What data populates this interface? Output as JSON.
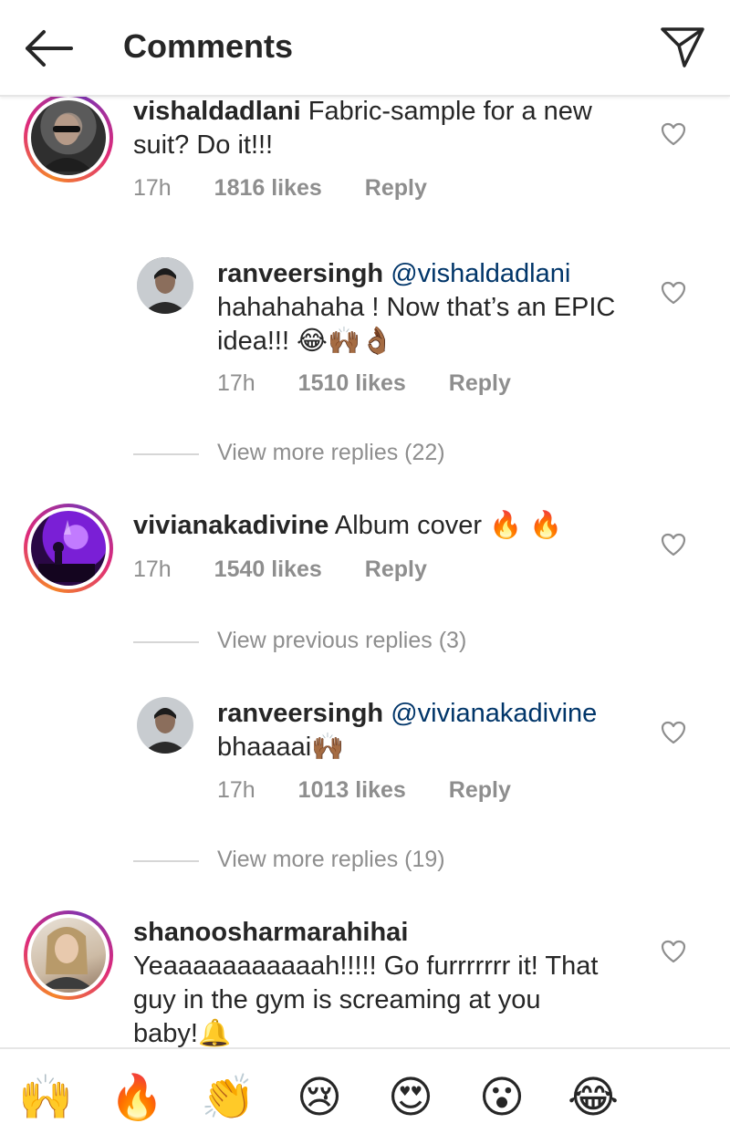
{
  "header": {
    "title": "Comments"
  },
  "comments": [
    {
      "user": "vishaldadlani",
      "text_line1": "Fabric-sample for a new",
      "text_line2": "suit? Do it!!!",
      "time": "17h",
      "likes": "1816 likes",
      "reply": "Reply"
    },
    {
      "user": "ranveersingh",
      "mention": "@vishaldadlani",
      "text_line1": "hahahahaha ! Now that’s an EPIC",
      "text_line2": "idea!!! 😂🙌🏾👌🏾",
      "time": "17h",
      "likes": "1510 likes",
      "reply": "Reply"
    },
    {
      "user": "vivianakadivine",
      "text_line1": "Album cover 🔥 🔥",
      "time": "17h",
      "likes": "1540 likes",
      "reply": "Reply"
    },
    {
      "user": "ranveersingh",
      "mention": "@vivianakadivine",
      "text_line1": "bhaaaai🙌🏾",
      "time": "17h",
      "likes": "1013 likes",
      "reply": "Reply"
    },
    {
      "user": "shanoosharmarahihai",
      "text_line1": "Yeaaaaaaaaaaah!!!!! Go furrrrrrr it! That",
      "text_line2": "guy in the gym is screaming at you",
      "text_line3": "baby!🔔"
    }
  ],
  "view_more_1": "View more replies (22)",
  "view_previous": "View previous replies (3)",
  "view_more_2": "View more replies (19)",
  "reactions": [
    "🙌",
    "🔥",
    "👏",
    "😢",
    "😍",
    "😮",
    "😂"
  ],
  "icons": {
    "back": "back-arrow-icon",
    "send": "paper-plane-icon",
    "like": "heart-outline-icon"
  }
}
